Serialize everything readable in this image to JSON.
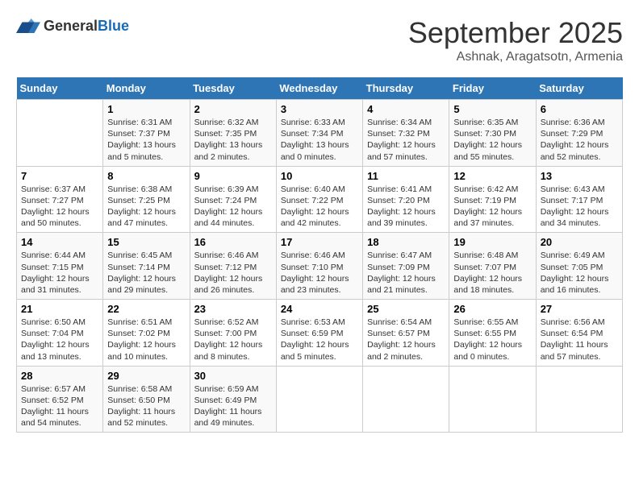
{
  "header": {
    "logo_general": "General",
    "logo_blue": "Blue",
    "month": "September 2025",
    "location": "Ashnak, Aragatsotn, Armenia"
  },
  "weekdays": [
    "Sunday",
    "Monday",
    "Tuesday",
    "Wednesday",
    "Thursday",
    "Friday",
    "Saturday"
  ],
  "weeks": [
    [
      {
        "day": "",
        "content": ""
      },
      {
        "day": "1",
        "content": "Sunrise: 6:31 AM\nSunset: 7:37 PM\nDaylight: 13 hours\nand 5 minutes."
      },
      {
        "day": "2",
        "content": "Sunrise: 6:32 AM\nSunset: 7:35 PM\nDaylight: 13 hours\nand 2 minutes."
      },
      {
        "day": "3",
        "content": "Sunrise: 6:33 AM\nSunset: 7:34 PM\nDaylight: 13 hours\nand 0 minutes."
      },
      {
        "day": "4",
        "content": "Sunrise: 6:34 AM\nSunset: 7:32 PM\nDaylight: 12 hours\nand 57 minutes."
      },
      {
        "day": "5",
        "content": "Sunrise: 6:35 AM\nSunset: 7:30 PM\nDaylight: 12 hours\nand 55 minutes."
      },
      {
        "day": "6",
        "content": "Sunrise: 6:36 AM\nSunset: 7:29 PM\nDaylight: 12 hours\nand 52 minutes."
      }
    ],
    [
      {
        "day": "7",
        "content": "Sunrise: 6:37 AM\nSunset: 7:27 PM\nDaylight: 12 hours\nand 50 minutes."
      },
      {
        "day": "8",
        "content": "Sunrise: 6:38 AM\nSunset: 7:25 PM\nDaylight: 12 hours\nand 47 minutes."
      },
      {
        "day": "9",
        "content": "Sunrise: 6:39 AM\nSunset: 7:24 PM\nDaylight: 12 hours\nand 44 minutes."
      },
      {
        "day": "10",
        "content": "Sunrise: 6:40 AM\nSunset: 7:22 PM\nDaylight: 12 hours\nand 42 minutes."
      },
      {
        "day": "11",
        "content": "Sunrise: 6:41 AM\nSunset: 7:20 PM\nDaylight: 12 hours\nand 39 minutes."
      },
      {
        "day": "12",
        "content": "Sunrise: 6:42 AM\nSunset: 7:19 PM\nDaylight: 12 hours\nand 37 minutes."
      },
      {
        "day": "13",
        "content": "Sunrise: 6:43 AM\nSunset: 7:17 PM\nDaylight: 12 hours\nand 34 minutes."
      }
    ],
    [
      {
        "day": "14",
        "content": "Sunrise: 6:44 AM\nSunset: 7:15 PM\nDaylight: 12 hours\nand 31 minutes."
      },
      {
        "day": "15",
        "content": "Sunrise: 6:45 AM\nSunset: 7:14 PM\nDaylight: 12 hours\nand 29 minutes."
      },
      {
        "day": "16",
        "content": "Sunrise: 6:46 AM\nSunset: 7:12 PM\nDaylight: 12 hours\nand 26 minutes."
      },
      {
        "day": "17",
        "content": "Sunrise: 6:46 AM\nSunset: 7:10 PM\nDaylight: 12 hours\nand 23 minutes."
      },
      {
        "day": "18",
        "content": "Sunrise: 6:47 AM\nSunset: 7:09 PM\nDaylight: 12 hours\nand 21 minutes."
      },
      {
        "day": "19",
        "content": "Sunrise: 6:48 AM\nSunset: 7:07 PM\nDaylight: 12 hours\nand 18 minutes."
      },
      {
        "day": "20",
        "content": "Sunrise: 6:49 AM\nSunset: 7:05 PM\nDaylight: 12 hours\nand 16 minutes."
      }
    ],
    [
      {
        "day": "21",
        "content": "Sunrise: 6:50 AM\nSunset: 7:04 PM\nDaylight: 12 hours\nand 13 minutes."
      },
      {
        "day": "22",
        "content": "Sunrise: 6:51 AM\nSunset: 7:02 PM\nDaylight: 12 hours\nand 10 minutes."
      },
      {
        "day": "23",
        "content": "Sunrise: 6:52 AM\nSunset: 7:00 PM\nDaylight: 12 hours\nand 8 minutes."
      },
      {
        "day": "24",
        "content": "Sunrise: 6:53 AM\nSunset: 6:59 PM\nDaylight: 12 hours\nand 5 minutes."
      },
      {
        "day": "25",
        "content": "Sunrise: 6:54 AM\nSunset: 6:57 PM\nDaylight: 12 hours\nand 2 minutes."
      },
      {
        "day": "26",
        "content": "Sunrise: 6:55 AM\nSunset: 6:55 PM\nDaylight: 12 hours\nand 0 minutes."
      },
      {
        "day": "27",
        "content": "Sunrise: 6:56 AM\nSunset: 6:54 PM\nDaylight: 11 hours\nand 57 minutes."
      }
    ],
    [
      {
        "day": "28",
        "content": "Sunrise: 6:57 AM\nSunset: 6:52 PM\nDaylight: 11 hours\nand 54 minutes."
      },
      {
        "day": "29",
        "content": "Sunrise: 6:58 AM\nSunset: 6:50 PM\nDaylight: 11 hours\nand 52 minutes."
      },
      {
        "day": "30",
        "content": "Sunrise: 6:59 AM\nSunset: 6:49 PM\nDaylight: 11 hours\nand 49 minutes."
      },
      {
        "day": "",
        "content": ""
      },
      {
        "day": "",
        "content": ""
      },
      {
        "day": "",
        "content": ""
      },
      {
        "day": "",
        "content": ""
      }
    ]
  ]
}
